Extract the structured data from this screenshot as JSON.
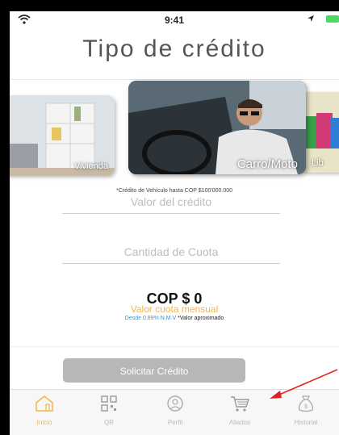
{
  "status_bar": {
    "time": "9:41"
  },
  "header": {
    "title": "Tipo de crédito"
  },
  "carousel": {
    "items": [
      {
        "label": "Vivienda"
      },
      {
        "label": "Carro/Moto"
      },
      {
        "label": "Lib"
      }
    ]
  },
  "note": "*Crédito de Vehículo hasta COP $100'000.000",
  "form": {
    "valor_placeholder": "Valor del crédito",
    "cuota_placeholder": "Cantidad de Cuota"
  },
  "summary": {
    "amount": "COP $ 0",
    "cuota_label": "Valor cuota mensual",
    "rate": "Desde 0.89% N.M.V",
    "approx": "*Valor aproximado"
  },
  "button": {
    "label": "Solicitar Crédito"
  },
  "tabbar": {
    "items": [
      {
        "label": "Inicio",
        "icon": "home-icon"
      },
      {
        "label": "QR",
        "icon": "qr-icon"
      },
      {
        "label": "Perfil",
        "icon": "profile-icon"
      },
      {
        "label": "Aliados",
        "icon": "cart-icon"
      },
      {
        "label": "Historial",
        "icon": "money-bag-icon"
      }
    ],
    "active_color": "#f5b54a",
    "inactive_color": "#bbbbbb"
  },
  "annotation": {
    "arrow_color": "#e02020"
  }
}
